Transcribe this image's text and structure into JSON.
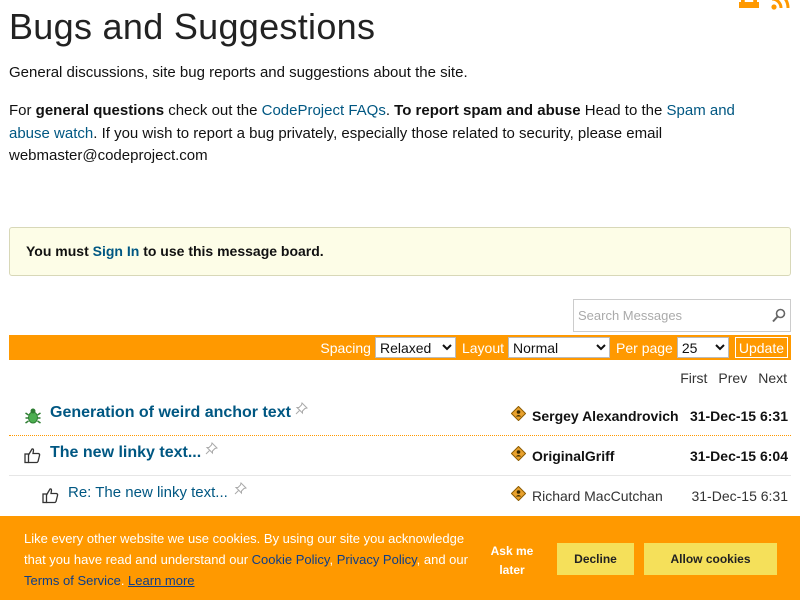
{
  "page": {
    "title": "Bugs and Suggestions",
    "description": "General discussions, site bug reports and suggestions about the site.",
    "help": {
      "p1": "For ",
      "general_questions": "general questions",
      "p2": " check out the ",
      "faq_link": "CodeProject FAQs",
      "p3": ". ",
      "report_spam": "To report spam and abuse",
      "p4": " Head to the ",
      "spam_link": "Spam and abuse watch",
      "p5": ". If you wish to report a bug privately, especially those related to security, please email webmaster@codeproject.com"
    }
  },
  "header_icons": [
    "print-icon",
    "rss-icon"
  ],
  "signin": {
    "before": "You must ",
    "link": "Sign In",
    "after": " to use this message board."
  },
  "search": {
    "placeholder": "Search Messages",
    "icon": "search-icon"
  },
  "toolbar": {
    "spacing_label": "Spacing",
    "spacing_value": "Relaxed",
    "layout_label": "Layout",
    "layout_value": "Normal",
    "perpage_label": "Per page",
    "perpage_value": "25",
    "update_label": "Update"
  },
  "pager": {
    "first": "First",
    "prev": "Prev",
    "next": "Next"
  },
  "messages": [
    {
      "type_icon": "bug-icon",
      "subject": "Generation of weird anchor text",
      "author": "Sergey Alexandrovich",
      "date": "31-Dec-15 6:31"
    },
    {
      "type_icon": "thumbs-up-icon",
      "subject": "The new linky text...",
      "author": "OriginalGriff",
      "date": "31-Dec-15 6:04"
    },
    {
      "type_icon": "thumbs-up-icon",
      "subject": "Re: The new linky text...",
      "author": "Richard MacCutchan",
      "date": "31-Dec-15 6:31"
    }
  ],
  "cookie": {
    "text1": "Like every other website we use cookies. By using our site you acknowledge that you have read and understand our ",
    "cookie_policy": "Cookie Policy",
    "sep1": ", ",
    "privacy_policy": "Privacy Policy",
    "text2": ", and our ",
    "terms": "Terms of Service",
    "sep2": ". ",
    "learn_more": "Learn more",
    "ask_later": "Ask me later",
    "decline": "Decline",
    "allow": "Allow cookies"
  },
  "colors": {
    "accent": "#ff9900",
    "link": "#005782",
    "notice_bg": "#fdfde7",
    "cookie_button": "#f5e05a"
  }
}
